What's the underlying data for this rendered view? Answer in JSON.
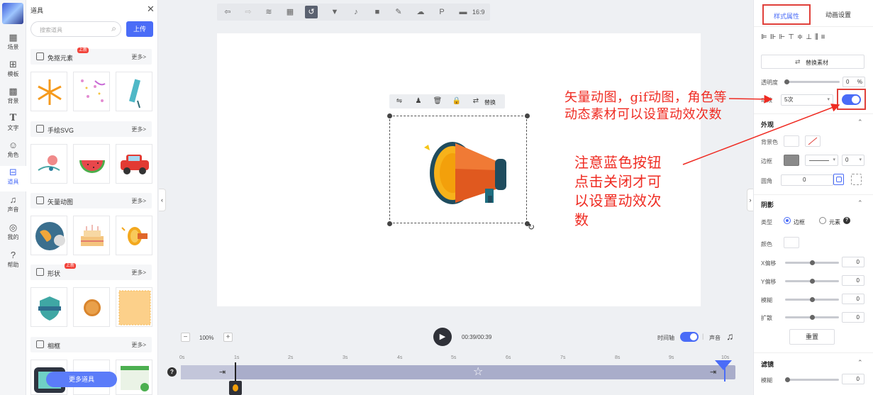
{
  "nav": {
    "items": [
      {
        "label": "场景",
        "icon": "grid-icon"
      },
      {
        "label": "模板",
        "icon": "template-icon"
      },
      {
        "label": "背景",
        "icon": "pattern-icon"
      },
      {
        "label": "文字",
        "icon": "text-icon"
      },
      {
        "label": "角色",
        "icon": "person-icon"
      },
      {
        "label": "道具",
        "icon": "bag-icon"
      },
      {
        "label": "声音",
        "icon": "music-icon"
      },
      {
        "label": "我的",
        "icon": "user-icon"
      },
      {
        "label": "帮助",
        "icon": "help-icon"
      }
    ],
    "active": "道具"
  },
  "props_panel": {
    "title": "道具",
    "search_placeholder": "搜索道具",
    "upload_label": "上传",
    "more_label": "更多>",
    "more_props_button": "更多道具",
    "sections": [
      {
        "title": "免抠元素",
        "badge": "上新"
      },
      {
        "title": "手绘SVG",
        "badge": ""
      },
      {
        "title": "矢量动图",
        "badge": ""
      },
      {
        "title": "形状",
        "badge": "上新"
      },
      {
        "title": "相框",
        "badge": ""
      }
    ]
  },
  "toolbar": {
    "ratio": "16:9"
  },
  "element_toolbar": {
    "replace_label": "替换"
  },
  "timeline": {
    "zoom": "100%",
    "time": "00:39/00:39",
    "timeline_label": "时间轴",
    "sound_label": "声音",
    "ticks": [
      "0s",
      "1s",
      "2s",
      "3s",
      "4s",
      "5s",
      "6s",
      "7s",
      "8s",
      "9s",
      "10s"
    ]
  },
  "right_panel": {
    "tabs": [
      "样式属性",
      "动画设置"
    ],
    "replace_material": "替换素材",
    "opacity_label": "透明度",
    "opacity_value": "0",
    "opacity_unit": "%",
    "effect_label": "动效",
    "effect_value": "5次",
    "appearance_title": "外观",
    "bgcolor_label": "背景色",
    "border_label": "边框",
    "border_width": "0",
    "radius_label": "圆角",
    "radius_value": "0",
    "shadow_title": "阴影",
    "type_label": "类型",
    "type_opt1": "边框",
    "type_opt2": "元素",
    "color_label": "颜色",
    "xoffset_label": "X偏移",
    "yoffset_label": "Y偏移",
    "blur_label": "模糊",
    "spread_label": "扩散",
    "xoffset": "0",
    "yoffset": "0",
    "blur": "0",
    "spread": "0",
    "reset_label": "重置",
    "filter_title": "滤镜",
    "filter_blur_label": "模糊",
    "filter_blur_value": "0"
  },
  "annotations": {
    "a1_line1": "矢量动图，gif动图，角色等",
    "a1_line2": "动态素材可以设置动效次数",
    "a2_line1": "注意蓝色按钮",
    "a2_line2": "点击关闭才可",
    "a2_line3": "以设置动效次",
    "a2_line4": "数"
  },
  "colors": {
    "accent": "#4a6cf7",
    "annotation": "#ef2b22"
  }
}
